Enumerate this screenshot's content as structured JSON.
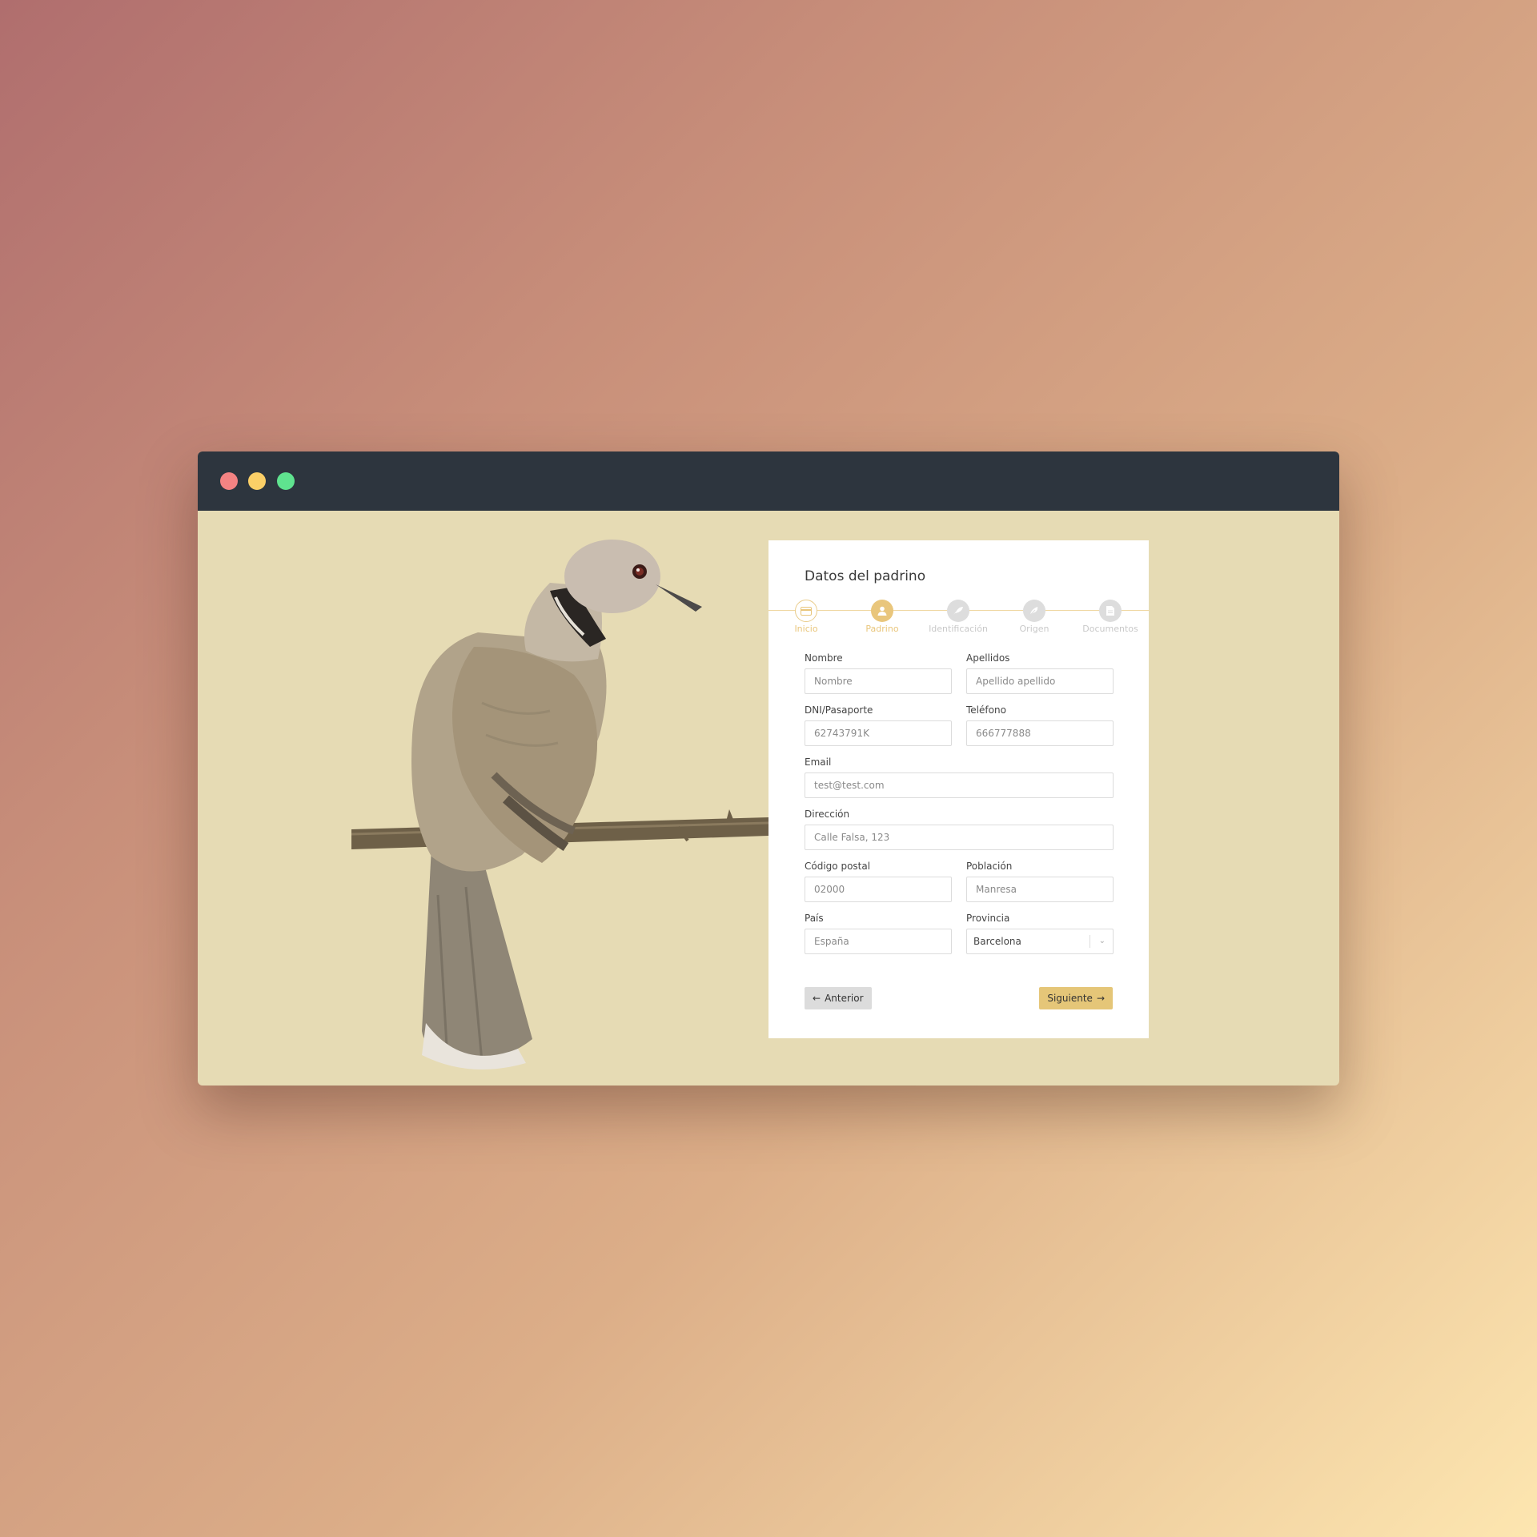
{
  "window": {
    "controls": [
      "close",
      "minimize",
      "maximize"
    ]
  },
  "form": {
    "title": "Datos del padrino",
    "steps": [
      {
        "label": "Inicio",
        "icon": "card-icon",
        "state": "done"
      },
      {
        "label": "Padrino",
        "icon": "user-icon",
        "state": "active"
      },
      {
        "label": "Identificación",
        "icon": "bird-icon",
        "state": "pending"
      },
      {
        "label": "Origen",
        "icon": "feather-icon",
        "state": "pending"
      },
      {
        "label": "Documentos",
        "icon": "document-icon",
        "state": "pending"
      }
    ],
    "fields": {
      "nombre": {
        "label": "Nombre",
        "placeholder": "Nombre"
      },
      "apellidos": {
        "label": "Apellidos",
        "placeholder": "Apellido apellido"
      },
      "dni": {
        "label": "DNI/Pasaporte",
        "placeholder": "62743791K"
      },
      "telefono": {
        "label": "Teléfono",
        "placeholder": "666777888"
      },
      "email": {
        "label": "Email",
        "placeholder": "test@test.com"
      },
      "direccion": {
        "label": "Dirección",
        "placeholder": "Calle Falsa, 123"
      },
      "codigo_postal": {
        "label": "Código postal",
        "placeholder": "02000"
      },
      "poblacion": {
        "label": "Población",
        "placeholder": "Manresa"
      },
      "pais": {
        "label": "País",
        "placeholder": "España"
      },
      "provincia": {
        "label": "Provincia",
        "value": "Barcelona"
      }
    },
    "buttons": {
      "prev": "Anterior",
      "next": "Siguiente"
    }
  },
  "colors": {
    "accent": "#e5c678",
    "titlebar": "#2d353e",
    "window_bg": "#e6dbb4"
  }
}
